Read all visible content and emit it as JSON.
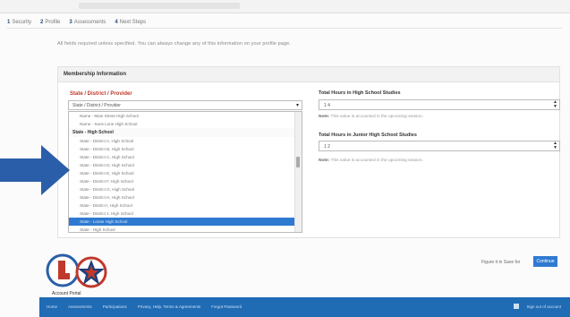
{
  "header": {
    "steps": [
      {
        "num": "1",
        "label": "Security"
      },
      {
        "num": "2",
        "label": "Profile"
      },
      {
        "num": "3",
        "label": "Assessments"
      },
      {
        "num": "4",
        "label": "Next Steps"
      }
    ]
  },
  "intro_text": "All fields required unless specified. You can always change any of this information on your profile page.",
  "section": {
    "title": "Membership Information",
    "district_label": "State / District / Provider",
    "district_select": {
      "value": "State / District / Provider",
      "options_top": [
        "Name - Main Street High School",
        "Name - Sans Lone High School"
      ],
      "group_label": "State - High School",
      "options": [
        "State - District A, High School",
        "State - District B, High School",
        "State - District C, High School",
        "State - District D, High School",
        "State - District E, High School",
        "State - District F, High School",
        "State - District G, High School",
        "State - District H, High School",
        "State - District I, High School",
        "State - District J, High School"
      ],
      "selected_option": "State - Loose High School",
      "last_option": "State - High School"
    },
    "hs_hours_label": "Total Hours in High School Studies",
    "hs_hours_value": "1 4",
    "hs_note_bold": "Note:",
    "hs_note": "This value is accounted in the upcoming season.",
    "jhs_hours_label": "Total Hours in Junior High School Studies",
    "jhs_hours_value": "1 2",
    "jhs_note_bold": "Note:",
    "jhs_note": "This value is accounted in the upcoming season."
  },
  "logo_caption": "Account Portal",
  "actions": {
    "save_label": "Figure it in Save for",
    "continue_label": "Continue"
  },
  "footer": {
    "links": [
      "Home",
      "Assessments",
      "Participations",
      "Privacy, Help, Terms & Agreements",
      "Forgot Password"
    ],
    "right_label": "Sign out of account"
  },
  "colors": {
    "accent": "#2f7ad1",
    "footer_bg": "#1f6bb4",
    "arrow": "#2a5ea8",
    "label_red": "#c0392b"
  }
}
